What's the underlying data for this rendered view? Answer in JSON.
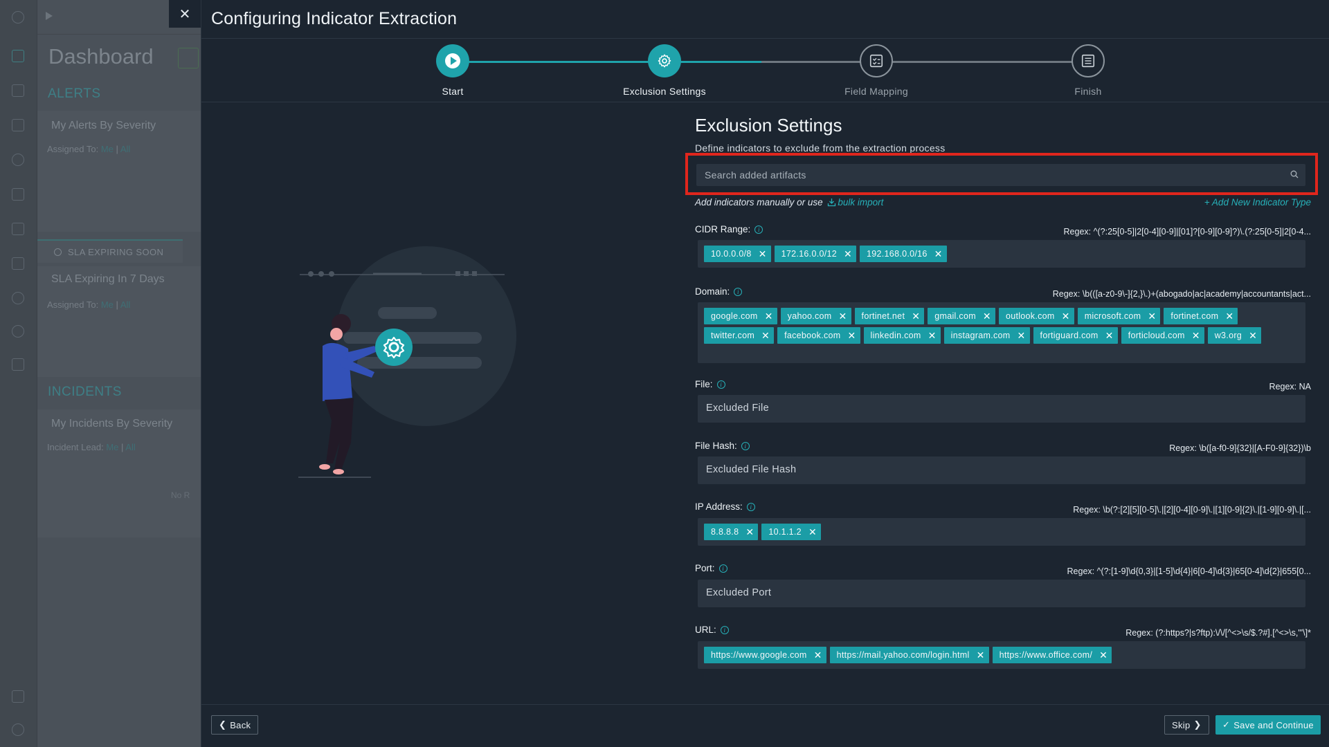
{
  "background": {
    "dashboard_title": "Dashboard",
    "alerts_section": "ALERTS",
    "alerts_card": "My Alerts By Severity",
    "alerts_assigned_prefix": "Assigned To:",
    "alerts_assigned_me": "Me",
    "alerts_assigned_sep": "|",
    "alerts_assigned_all": "All",
    "sla_tab": "SLA EXPIRING SOON",
    "sla_card": "SLA Expiring In 7 Days",
    "sla_assigned_prefix": "Assigned To:",
    "sla_assigned_me": "Me",
    "sla_assigned_sep": "|",
    "sla_assigned_all": "All",
    "incidents_section": "INCIDENTS",
    "incidents_card": "My Incidents By Severity",
    "incidents_lead_prefix": "Incident Lead:",
    "incidents_lead_me": "Me",
    "incidents_lead_sep": "|",
    "incidents_lead_all": "All",
    "no_data": "No R"
  },
  "modal": {
    "close_glyph": "✕",
    "title": "Configuring Indicator Extraction"
  },
  "steps": [
    {
      "label": "Start",
      "state": "done",
      "icon": "play-icon"
    },
    {
      "label": "Exclusion Settings",
      "state": "current",
      "icon": "gear-icon"
    },
    {
      "label": "Field Mapping",
      "state": "future",
      "icon": "checklist-icon"
    },
    {
      "label": "Finish",
      "state": "future",
      "icon": "document-icon"
    }
  ],
  "form": {
    "title": "Exclusion Settings",
    "subtitle": "Define indicators to exclude from the extraction process",
    "search_placeholder": "Search added artifacts",
    "helper_text": "Add indicators manually or use",
    "bulk_import": "bulk import",
    "add_new": "+ Add New Indicator Type"
  },
  "fields": {
    "cidr": {
      "label": "CIDR Range:",
      "regex": "Regex: ^(?:25[0-5]|2[0-4][0-9]|[01]?[0-9][0-9]?)\\.(?:25[0-5]|2[0-4...",
      "chips": [
        "10.0.0.0/8",
        "172.16.0.0/12",
        "192.168.0.0/16"
      ]
    },
    "domain": {
      "label": "Domain:",
      "regex": "Regex: \\b(([a-z0-9\\-]{2,}\\.)+(abogado|ac|academy|accountants|act...",
      "chips": [
        "google.com",
        "yahoo.com",
        "fortinet.net",
        "gmail.com",
        "outlook.com",
        "microsoft.com",
        "fortinet.com",
        "twitter.com",
        "facebook.com",
        "linkedin.com",
        "instagram.com",
        "fortiguard.com",
        "forticloud.com",
        "w3.org"
      ]
    },
    "file": {
      "label": "File:",
      "regex": "Regex: NA",
      "placeholder": "Excluded File"
    },
    "file_hash": {
      "label": "File Hash:",
      "regex": "Regex: \\b([a-f0-9]{32}|[A-F0-9]{32})\\b",
      "placeholder": "Excluded File Hash"
    },
    "ip": {
      "label": "IP Address:",
      "regex": "Regex: \\b(?:[2][5][0-5]\\.|[2][0-4][0-9]\\.|[1][0-9]{2}\\.|[1-9][0-9]\\.|[...",
      "chips": [
        "8.8.8.8",
        "10.1.1.2"
      ]
    },
    "port": {
      "label": "Port:",
      "regex": "Regex: ^(?:[1-9]\\d{0,3}|[1-5]\\d{4}|6[0-4]\\d{3}|65[0-4]\\d{2}|655[0...",
      "placeholder": "Excluded Port"
    },
    "url": {
      "label": "URL:",
      "regex": "Regex: (?:https?|s?ftp):\\/\\/[^<>\\s/$.?#].[^<>\\s,\"'\\]*",
      "chips": [
        "https://www.google.com",
        "https://mail.yahoo.com/login.html",
        "https://www.office.com/"
      ]
    }
  },
  "chip_remove_glyph": "✕",
  "info_glyph": "i",
  "footer": {
    "back_label": "Back",
    "skip_label": "Skip",
    "save_label": "Save and Continue"
  },
  "colors": {
    "accent": "#1fa3ab",
    "background": "#1c2530",
    "input_bg": "#2a3440",
    "highlight": "#e0261d"
  }
}
